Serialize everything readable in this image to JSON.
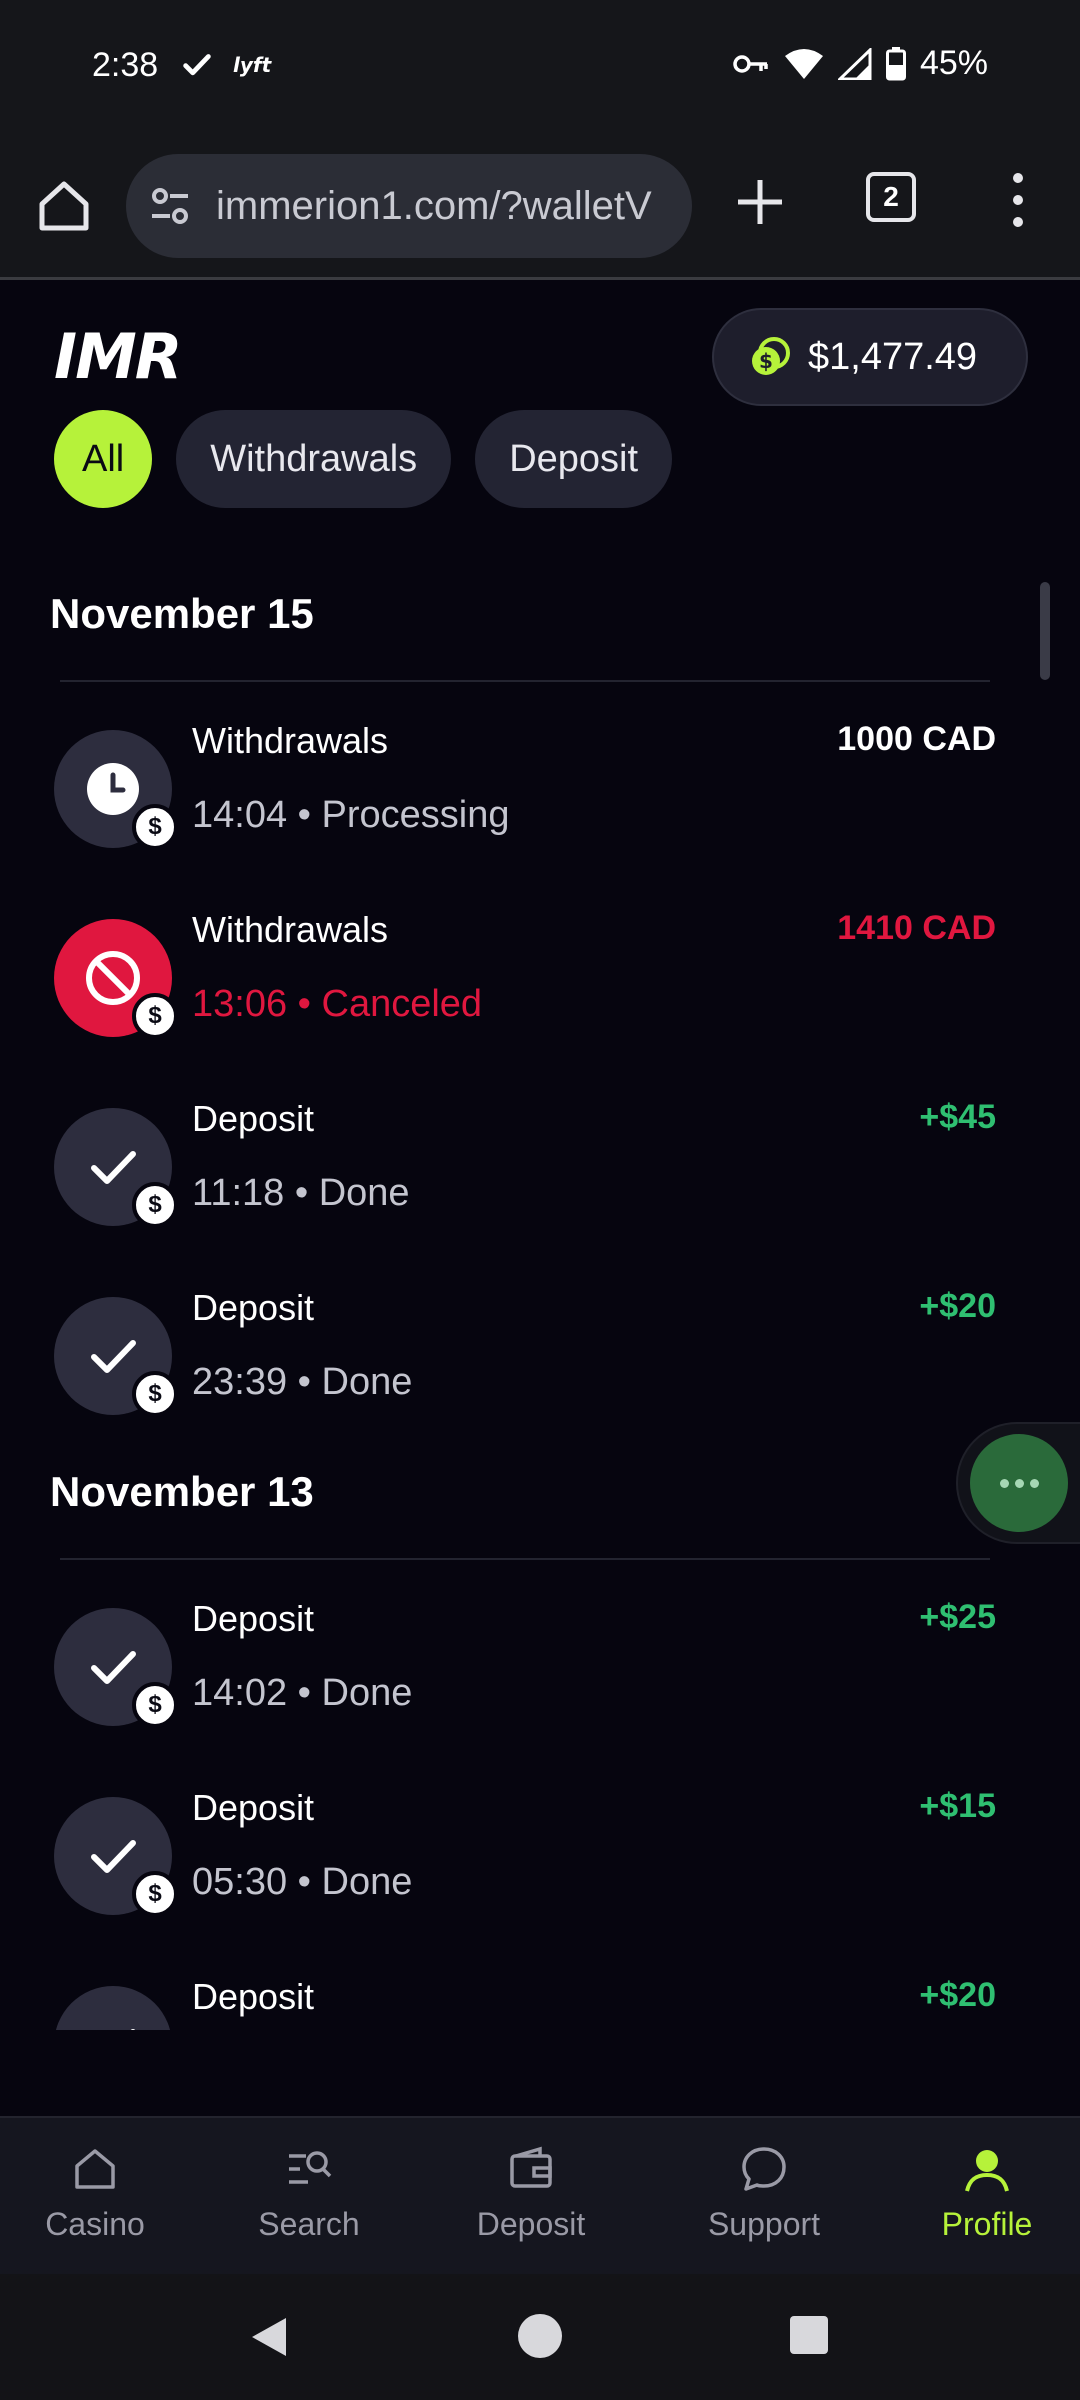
{
  "status_bar": {
    "time": "2:38",
    "battery": "45%"
  },
  "browser": {
    "url": "immerion1.com/?walletV",
    "tab_count": "2"
  },
  "header": {
    "logo": "IMR",
    "balance": "$1,477.49"
  },
  "filters": [
    {
      "label": "All",
      "active": true
    },
    {
      "label": "Withdrawals",
      "active": false
    },
    {
      "label": "Deposit",
      "active": false
    }
  ],
  "sections": [
    {
      "title": "November 15",
      "transactions": [
        {
          "type": "Withdrawals",
          "time": "14:04",
          "status": "Processing",
          "amount": "1000 CAD",
          "icon": "clock-icon",
          "tone": "neutral"
        },
        {
          "type": "Withdrawals",
          "time": "13:06",
          "status": "Canceled",
          "amount": "1410 CAD",
          "icon": "block-icon",
          "tone": "red"
        },
        {
          "type": "Deposit",
          "time": "11:18",
          "status": "Done",
          "amount": "+$45",
          "icon": "check-icon",
          "tone": "green"
        },
        {
          "type": "Deposit",
          "time": "23:39",
          "status": "Done",
          "amount": "+$20",
          "icon": "check-icon",
          "tone": "green"
        }
      ]
    },
    {
      "title": "November 13",
      "transactions": [
        {
          "type": "Deposit",
          "time": "14:02",
          "status": "Done",
          "amount": "+$25",
          "icon": "check-icon",
          "tone": "green"
        },
        {
          "type": "Deposit",
          "time": "05:30",
          "status": "Done",
          "amount": "+$15",
          "icon": "check-icon",
          "tone": "green"
        },
        {
          "type": "Deposit",
          "time": "",
          "status": "",
          "amount": "+$20",
          "icon": "check-icon",
          "tone": "green"
        }
      ]
    }
  ],
  "badge_symbol": "$",
  "bottom_nav": [
    {
      "label": "Casino",
      "icon": "home-icon",
      "active": false
    },
    {
      "label": "Search",
      "icon": "search-icon",
      "active": false
    },
    {
      "label": "Deposit",
      "icon": "wallet-icon",
      "active": false
    },
    {
      "label": "Support",
      "icon": "chat-icon",
      "active": false
    },
    {
      "label": "Profile",
      "icon": "profile-icon",
      "active": true
    }
  ],
  "colors": {
    "accent": "#b6f23a",
    "red": "#e0173f",
    "green": "#2fbf71",
    "background": "#06050f"
  }
}
